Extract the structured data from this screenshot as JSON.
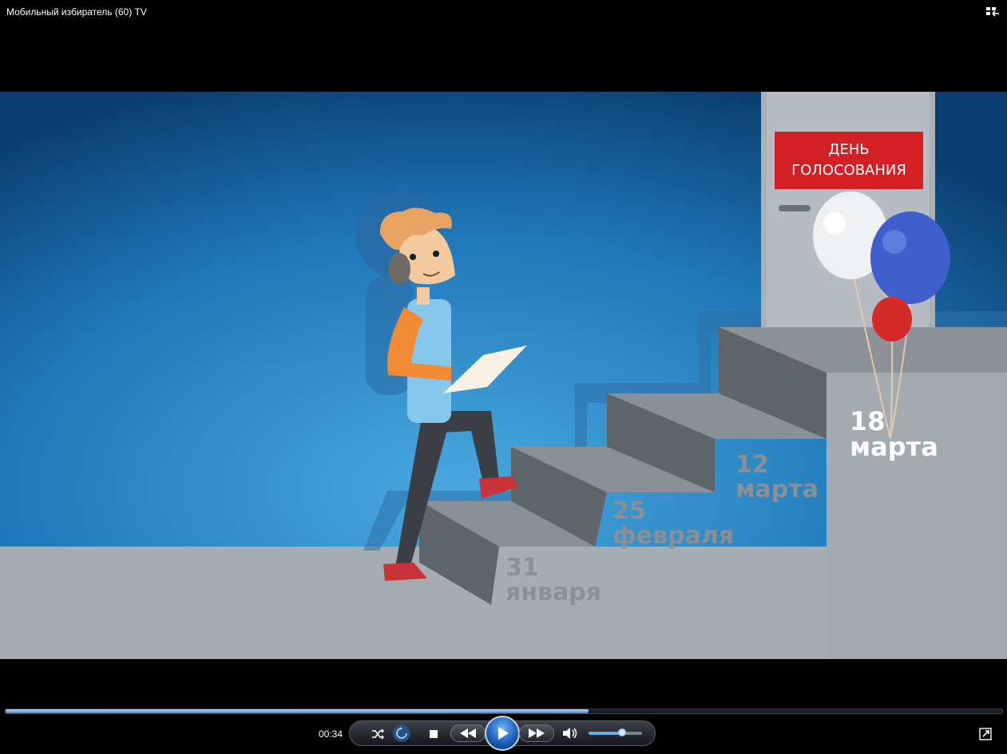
{
  "window": {
    "title": "Мобильный избиратель (60) TV"
  },
  "video": {
    "sign_line1": "ДЕНЬ",
    "sign_line2": "ГОЛОСОВАНИЯ",
    "steps": [
      {
        "day": "31",
        "month": "января"
      },
      {
        "day": "25",
        "month": "февраля"
      },
      {
        "day": "12",
        "month": "марта"
      },
      {
        "day": "18",
        "month": "марта"
      }
    ]
  },
  "player": {
    "current_time": "00:34",
    "progress": 0.585,
    "volume": 0.63,
    "state": "paused"
  },
  "icons": {
    "switch": "switch-to-library-icon",
    "shuffle": "shuffle-icon",
    "repeat": "repeat-icon",
    "stop": "stop-icon",
    "previous": "rewind-icon",
    "play": "play-icon",
    "next": "fast-forward-icon",
    "mute": "speaker-icon",
    "fullscreen": "fullscreen-icon"
  },
  "colors": {
    "sign_red": "#d32026",
    "accent_blue": "#3d86d6",
    "balloon_white": "#eef0f2",
    "balloon_blue": "#3f5fcc",
    "balloon_red": "#d42a2a"
  }
}
